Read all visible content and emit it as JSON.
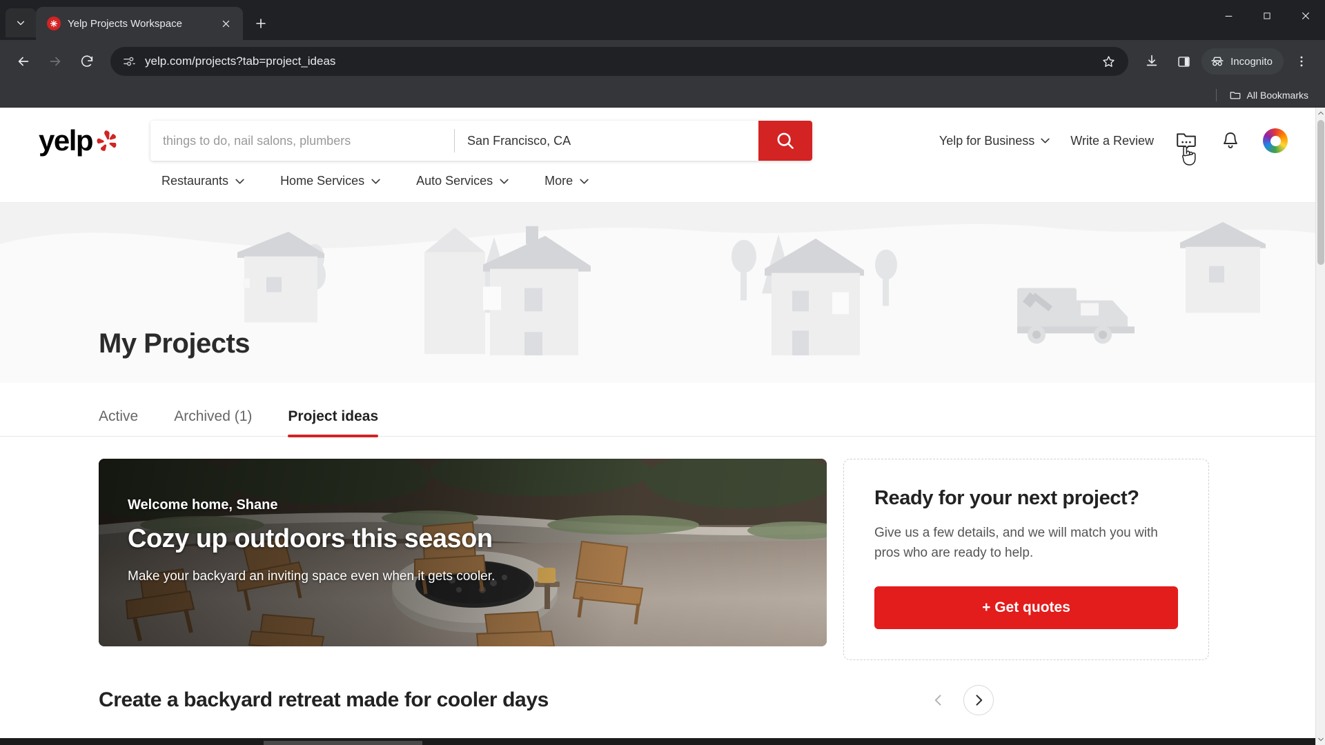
{
  "browser": {
    "tab": {
      "title": "Yelp Projects Workspace",
      "favicon_icon": "yelp-burst-icon",
      "close_icon": "close-icon"
    },
    "tab_search_icon": "chevron-down-icon",
    "new_tab_icon": "plus-icon",
    "window_controls": {
      "minimize": "minimize-icon",
      "maximize": "maximize-icon",
      "close": "close-icon"
    },
    "nav": {
      "back_icon": "back-arrow-icon",
      "forward_icon": "forward-arrow-icon",
      "reload_icon": "reload-icon"
    },
    "omnibox": {
      "url": "yelp.com/projects?tab=project_ideas",
      "site_info_icon": "page-info-icon",
      "bookmark_icon": "star-icon"
    },
    "toolbar": {
      "download_icon": "download-icon",
      "side_panel_icon": "side-panel-icon",
      "incognito_label": "Incognito",
      "incognito_icon": "incognito-icon",
      "menu_icon": "three-dot-menu-icon"
    },
    "bookmarks_bar": {
      "all_bookmarks_label": "All Bookmarks",
      "folder_icon": "folder-icon"
    }
  },
  "yelp": {
    "logo_text": "yelp",
    "search": {
      "find_placeholder": "things to do, nail salons, plumbers",
      "find_value": "",
      "location_placeholder": "San Francisco, CA",
      "location_value": "San Francisco, CA",
      "search_button_icon": "search-icon"
    },
    "header_nav": {
      "business_label": "Yelp for Business",
      "business_chevron_icon": "chevron-down-icon",
      "write_review_label": "Write a Review",
      "messages_icon": "messages-icon",
      "notifications_icon": "bell-icon",
      "avatar_icon": "user-avatar"
    },
    "categories": [
      {
        "label": "Restaurants",
        "icon": "chevron-down-icon"
      },
      {
        "label": "Home Services",
        "icon": "chevron-down-icon"
      },
      {
        "label": "Auto Services",
        "icon": "chevron-down-icon"
      },
      {
        "label": "More",
        "icon": "chevron-down-icon"
      }
    ]
  },
  "page": {
    "title": "My Projects",
    "tabs": [
      {
        "label": "Active",
        "active": false
      },
      {
        "label": "Archived (1)",
        "active": false
      },
      {
        "label": "Project ideas",
        "active": true
      }
    ],
    "hero": {
      "welcome": "Welcome home, Shane",
      "headline": "Cozy up outdoors this season",
      "subhead": "Make your backyard an inviting space even when it gets cooler.",
      "image_description": "backyard patio with Adirondack chairs around a stone fire pit"
    },
    "promo_card": {
      "title": "Ready for your next project?",
      "body": "Give us a few details, and we will match you with pros who are ready to help.",
      "cta_label": "+ Get quotes"
    },
    "carousel": {
      "title": "Create a backyard retreat made for cooler days",
      "prev_icon": "chevron-left-icon",
      "next_icon": "chevron-right-icon"
    }
  },
  "colors": {
    "yelp_red": "#d32323",
    "cta_red": "#e31c1c",
    "chrome_dark": "#202124",
    "chrome_toolbar": "#35363a"
  }
}
